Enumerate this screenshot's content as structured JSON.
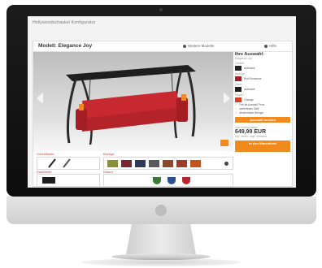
{
  "page": {
    "title": "Hollywoodschaukel Konfigurator",
    "model_title": "Modell: Elegance Joy",
    "link_more_models": "Weitere Modelle",
    "link_help": "Hilfe"
  },
  "viewer": {
    "prev_icon": "chevron-left-icon",
    "next_icon": "chevron-right-icon",
    "zoom_icon": "zoom-icon"
  },
  "sidebar": {
    "heading": "Ihre Auswahl:",
    "subtitle": "Elegance Joy",
    "sections": [
      {
        "label": "Gestell:",
        "value": "anthrazit",
        "color": "#222222"
      },
      {
        "label": "Bezüge:",
        "value": "Rot Bordeaux",
        "color": "#a31f24"
      },
      {
        "label": "Dach:",
        "value": "anthrazit",
        "color": "#1e1e1e"
      },
      {
        "label": "Kissen:",
        "value": "Orange",
        "color": "#d8401f"
      }
    ],
    "checks": [
      "Frei ab Auswahl Preis",
      "wetterfester Stoff",
      "abnehmbare Bezüge"
    ],
    "auswahl_button": "Auswahl merken",
    "price_label": "Ihre Konfiguration",
    "price_old": "649,99 EUR",
    "price_note": "inkl. MwSt. zzgl. Versand",
    "cart_button": "In den Warenkorb"
  },
  "options": {
    "gestell_label": "Gestellfarbe",
    "bezug_label": "Bezüge",
    "dach_label": "Dachfarbe",
    "kissen_label": "Kissen",
    "bezug_colors": [
      "#8a8f3a",
      "#7a2530",
      "#2f3a57",
      "#5a5a5a",
      "#8a4a2a",
      "#a23a2a",
      "#c4541f"
    ],
    "kissen_colors": [
      "#3a7a3a",
      "#2e4f8f",
      "#b8262a"
    ]
  }
}
